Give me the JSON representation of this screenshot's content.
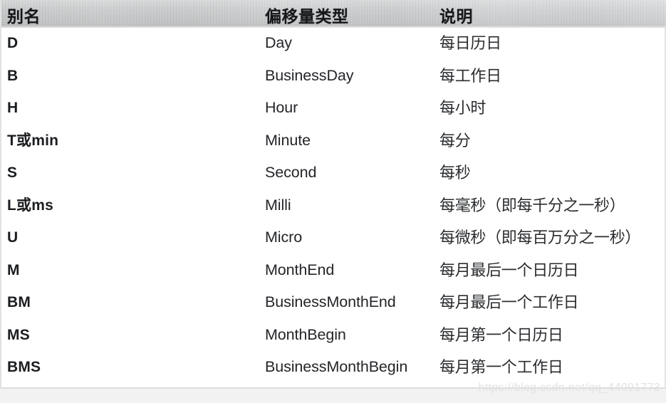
{
  "table": {
    "columns": [
      "别名",
      "偏移量类型",
      "说明"
    ],
    "rows": [
      {
        "alias": "D",
        "offset_type": "Day",
        "description": "每日历日"
      },
      {
        "alias": "B",
        "offset_type": "BusinessDay",
        "description": "每工作日"
      },
      {
        "alias": "H",
        "offset_type": "Hour",
        "description": "每小时"
      },
      {
        "alias": "T或min",
        "offset_type": "Minute",
        "description": "每分"
      },
      {
        "alias": "S",
        "offset_type": "Second",
        "description": "每秒"
      },
      {
        "alias": "L或ms",
        "offset_type": "Milli",
        "description": "每毫秒（即每千分之一秒）"
      },
      {
        "alias": "U",
        "offset_type": "Micro",
        "description": "每微秒（即每百万分之一秒）"
      },
      {
        "alias": "M",
        "offset_type": "MonthEnd",
        "description": "每月最后一个日历日"
      },
      {
        "alias": "BM",
        "offset_type": "BusinessMonthEnd",
        "description": "每月最后一个工作日"
      },
      {
        "alias": "MS",
        "offset_type": "MonthBegin",
        "description": "每月第一个日历日"
      },
      {
        "alias": "BMS",
        "offset_type": "BusinessMonthBegin",
        "description": "每月第一个工作日"
      }
    ]
  },
  "watermark": {
    "text": "https://blog.csdn.net/qq_44091773"
  },
  "colors": {
    "header_background": "#c8caca",
    "header_text": "#15171a",
    "body_text": "#1b1d20",
    "page_background": "#ffffff",
    "footer_background": "#f2f2f2",
    "watermark_text": "#e2e2e2",
    "border": "#e2e2e2"
  }
}
